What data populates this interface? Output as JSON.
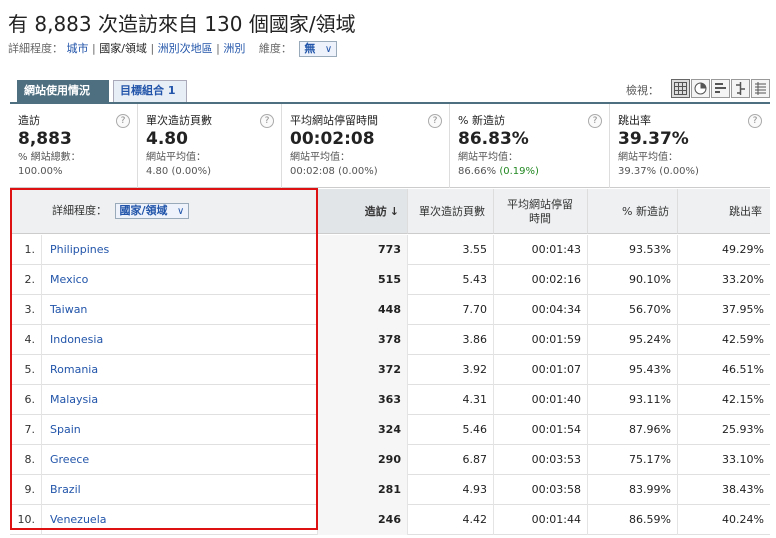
{
  "header": {
    "title": "有 8,883 次造訪來自 130 個國家/領域",
    "detail_label": "詳細程度：",
    "links": [
      "城市",
      "國家/領域",
      "洲別次地區",
      "洲別"
    ],
    "dimension_label": "維度：",
    "dimension_value": "無"
  },
  "tabs": [
    {
      "label": "網站使用情況"
    },
    {
      "label": "目標組合 1"
    }
  ],
  "view_label": "檢視：",
  "view_buttons": [
    "table-view-icon",
    "pie-view-icon",
    "bar-view-icon",
    "compare-view-icon",
    "pivot-view-icon"
  ],
  "metrics": [
    {
      "name": "造訪",
      "value": "8,883",
      "sub1": "% 網站總數：",
      "sub2": "100.00%"
    },
    {
      "name": "單次造訪頁數",
      "value": "4.80",
      "sub1": "網站平均值：",
      "sub2": "4.80 (0.00%)"
    },
    {
      "name": "平均網站停留時間",
      "value": "00:02:08",
      "sub1": "網站平均值：",
      "sub2": "00:02:08 (0.00%)"
    },
    {
      "name": "% 新造訪",
      "value": "86.83%",
      "sub1": "網站平均值：",
      "sub2a": "86.66% ",
      "sub2b": "(0.19%)"
    },
    {
      "name": "跳出率",
      "value": "39.37%",
      "sub1": "網站平均值：",
      "sub2": "39.37% (0.00%)"
    }
  ],
  "table": {
    "detail_label": "詳細程度：",
    "detail_value": "國家/領域",
    "columns": [
      "造訪",
      "單次造訪頁數",
      "平均網站停留時間",
      "% 新造訪",
      "跳出率"
    ],
    "rows": [
      {
        "idx": "1.",
        "country": "Philippines",
        "visits": "773",
        "pages": "3.55",
        "time": "00:01:43",
        "new": "93.53%",
        "bounce": "49.29%"
      },
      {
        "idx": "2.",
        "country": "Mexico",
        "visits": "515",
        "pages": "5.43",
        "time": "00:02:16",
        "new": "90.10%",
        "bounce": "33.20%"
      },
      {
        "idx": "3.",
        "country": "Taiwan",
        "visits": "448",
        "pages": "7.70",
        "time": "00:04:34",
        "new": "56.70%",
        "bounce": "37.95%"
      },
      {
        "idx": "4.",
        "country": "Indonesia",
        "visits": "378",
        "pages": "3.86",
        "time": "00:01:59",
        "new": "95.24%",
        "bounce": "42.59%"
      },
      {
        "idx": "5.",
        "country": "Romania",
        "visits": "372",
        "pages": "3.92",
        "time": "00:01:07",
        "new": "95.43%",
        "bounce": "46.51%"
      },
      {
        "idx": "6.",
        "country": "Malaysia",
        "visits": "363",
        "pages": "4.31",
        "time": "00:01:40",
        "new": "93.11%",
        "bounce": "42.15%"
      },
      {
        "idx": "7.",
        "country": "Spain",
        "visits": "324",
        "pages": "5.46",
        "time": "00:01:54",
        "new": "87.96%",
        "bounce": "25.93%"
      },
      {
        "idx": "8.",
        "country": "Greece",
        "visits": "290",
        "pages": "6.87",
        "time": "00:03:53",
        "new": "75.17%",
        "bounce": "33.10%"
      },
      {
        "idx": "9.",
        "country": "Brazil",
        "visits": "281",
        "pages": "4.93",
        "time": "00:03:58",
        "new": "83.99%",
        "bounce": "38.43%"
      },
      {
        "idx": "10.",
        "country": "Venezuela",
        "visits": "246",
        "pages": "4.42",
        "time": "00:01:44",
        "new": "86.59%",
        "bounce": "40.24%"
      }
    ]
  },
  "colors": {
    "accent": "#4d6f80",
    "link": "#2255aa",
    "highlight": "#dd1111",
    "positive": "#228822"
  }
}
